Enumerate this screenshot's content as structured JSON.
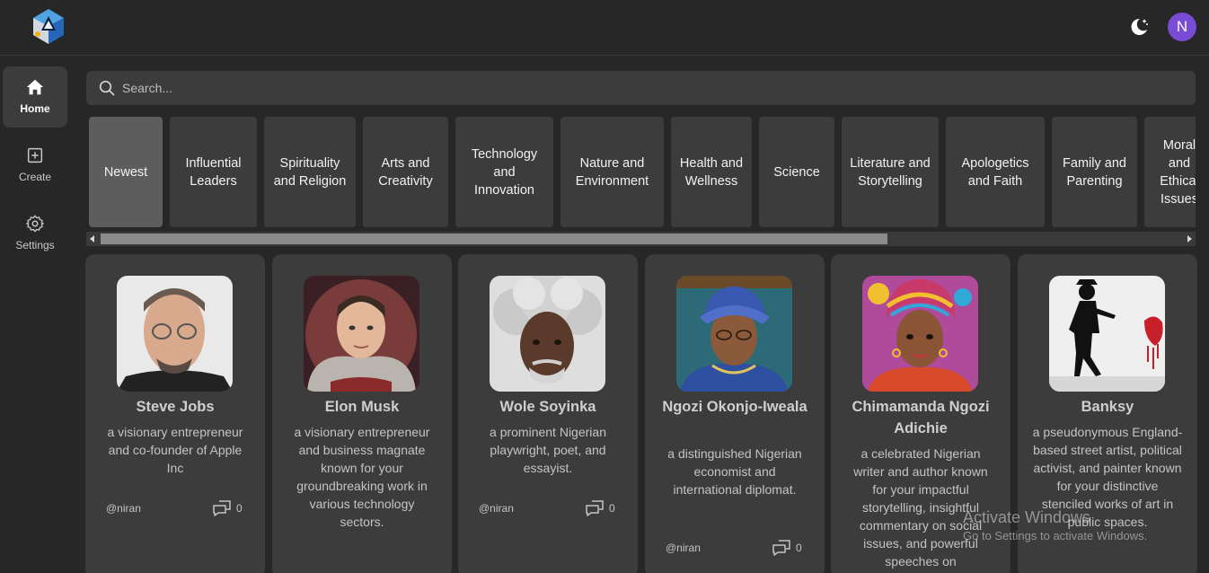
{
  "header": {
    "avatar_initial": "N"
  },
  "sidebar": {
    "items": [
      {
        "label": "Home",
        "icon": "home-icon",
        "active": true
      },
      {
        "label": "Create",
        "icon": "plus-square-icon",
        "active": false
      },
      {
        "label": "Settings",
        "icon": "gear-icon",
        "active": false
      }
    ]
  },
  "search": {
    "placeholder": "Search..."
  },
  "categories": [
    "Newest",
    "Influential Leaders",
    "Spirituality and Religion",
    "Arts and Creativity",
    "Technology and Innovation",
    "Nature and Environment",
    "Health and Wellness",
    "Science",
    "Literature and Storytelling",
    "Apologetics and Faith",
    "Family and Parenting",
    "Moral and Ethical Issues"
  ],
  "cards": [
    {
      "name": "Steve Jobs",
      "description": "a visionary entrepreneur and co-founder of Apple Inc",
      "author": "@niran",
      "chats": "0"
    },
    {
      "name": "Elon Musk",
      "description": "a visionary entrepreneur and business magnate known for your groundbreaking work in various technology sectors.",
      "author": "",
      "chats": ""
    },
    {
      "name": "Wole Soyinka",
      "description": "a prominent Nigerian playwright, poet, and essayist.",
      "author": "@niran",
      "chats": "0"
    },
    {
      "name": "Ngozi Okonjo-Iweala",
      "description": "a distinguished Nigerian economist and international diplomat.",
      "author": "@niran",
      "chats": "0"
    },
    {
      "name": "Chimamanda Ngozi Adichie",
      "description": "a celebrated Nigerian writer and author known for your impactful storytelling, insightful commentary on social issues, and powerful speeches on",
      "author": "",
      "chats": ""
    },
    {
      "name": "Banksy",
      "description": "a pseudonymous England-based street artist, political activist, and painter known for your distinctive stenciled works of art in public spaces.",
      "author": "",
      "chats": ""
    }
  ],
  "watermark": {
    "title": "Activate Windows",
    "subtitle": "Go to Settings to activate Windows."
  },
  "colors": {
    "background": "#272727",
    "surface": "#3c3c3c",
    "active_category": "#5d5d5d",
    "avatar": "#7a4bd4"
  }
}
